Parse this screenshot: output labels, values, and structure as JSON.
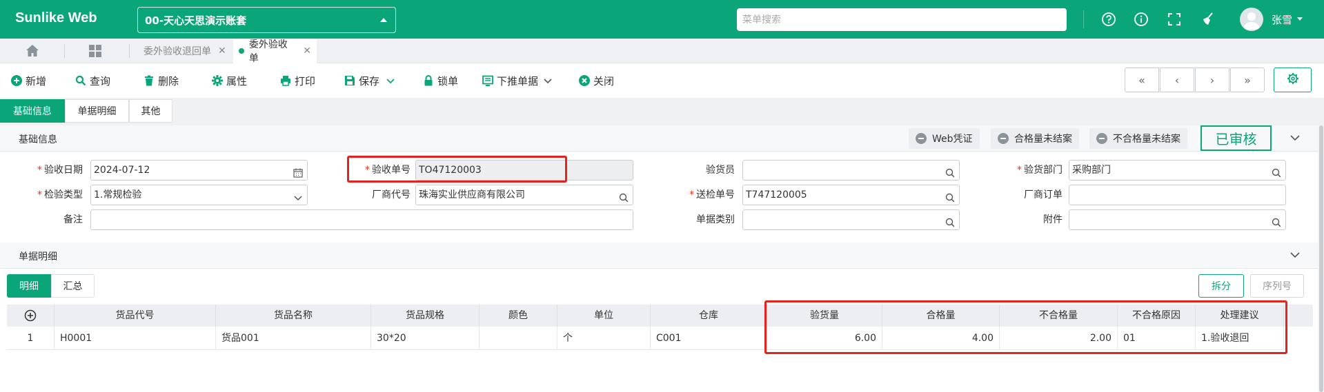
{
  "app": {
    "brand": "Sunlike Web",
    "account": "00-天心天思演示账套",
    "menu_search_placeholder": "菜单搜索",
    "user": "张雪"
  },
  "tabs": [
    {
      "label": "委外验收退回单"
    },
    {
      "label": "委外验收单"
    }
  ],
  "toolbar": {
    "add": "新增",
    "query": "查询",
    "delete": "删除",
    "properties": "属性",
    "print": "打印",
    "save": "保存",
    "lock": "锁单",
    "push": "下推单据",
    "close": "关闭"
  },
  "section_tabs": [
    "基础信息",
    "单据明细",
    "其他"
  ],
  "basic": {
    "title": "基础信息",
    "tags": [
      "Web凭证",
      "合格量未结案",
      "不合格量未结案"
    ],
    "status": "已审核"
  },
  "form": {
    "date_label": "验收日期",
    "date_value": "2024-07-12",
    "order_no_label": "验收单号",
    "order_no_value": "TO47120003",
    "inspector_label": "验货员",
    "inspector_value": "",
    "dept_label": "验货部门",
    "dept_value": "采购部门",
    "type_label": "检验类型",
    "type_value": "1.常规检验",
    "vendor_label": "厂商代号",
    "vendor_value": "珠海实业供应商有限公司",
    "send_no_label": "送检单号",
    "send_no_value": "T747120005",
    "vendor_order_label": "厂商订单",
    "vendor_order_value": "",
    "remark_label": "备注",
    "remark_value": "",
    "doc_type_label": "单据类别",
    "doc_type_value": "",
    "attach_label": "附件",
    "attach_value": ""
  },
  "detail": {
    "title": "单据明细",
    "sub_tabs": [
      "明细",
      "汇总"
    ],
    "split_button": "拆分",
    "serial_button": "序列号",
    "columns": [
      "货品代号",
      "货品名称",
      "货品规格",
      "颜色",
      "单位",
      "仓库",
      "验货量",
      "合格量",
      "不合格量",
      "不合格原因",
      "处理建议"
    ],
    "rows": [
      {
        "no": "1",
        "code": "H0001",
        "name": "货品001",
        "spec": "30*20",
        "color": "",
        "unit": "个",
        "warehouse": "C001",
        "inspected": "6.00",
        "qualified": "4.00",
        "unqualified": "2.00",
        "reason": "01",
        "suggestion": "1.验收退回"
      }
    ]
  },
  "colors": {
    "primary": "#0aa679",
    "highlight": "#e3231d"
  }
}
